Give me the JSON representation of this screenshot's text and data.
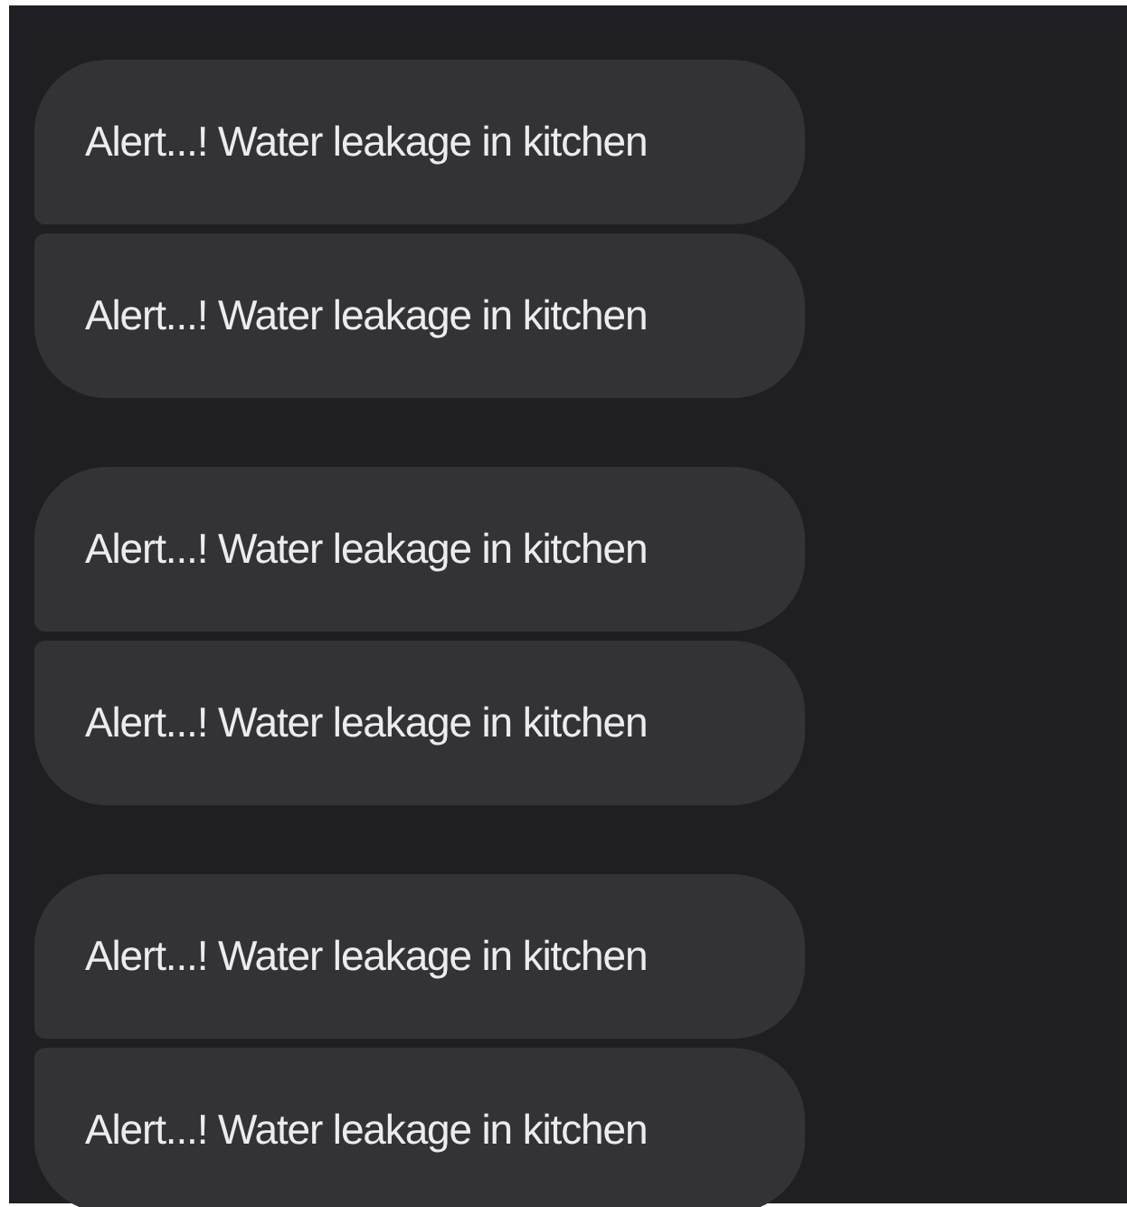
{
  "message_groups": [
    {
      "messages": [
        {
          "text": "Alert...! Water leakage in kitchen"
        },
        {
          "text": "Alert...! Water leakage in kitchen"
        }
      ]
    },
    {
      "messages": [
        {
          "text": "Alert...! Water leakage in kitchen"
        },
        {
          "text": "Alert...! Water leakage in kitchen"
        }
      ]
    },
    {
      "messages": [
        {
          "text": "Alert...! Water leakage in kitchen"
        },
        {
          "text": "Alert...! Water leakage in kitchen"
        }
      ]
    }
  ]
}
